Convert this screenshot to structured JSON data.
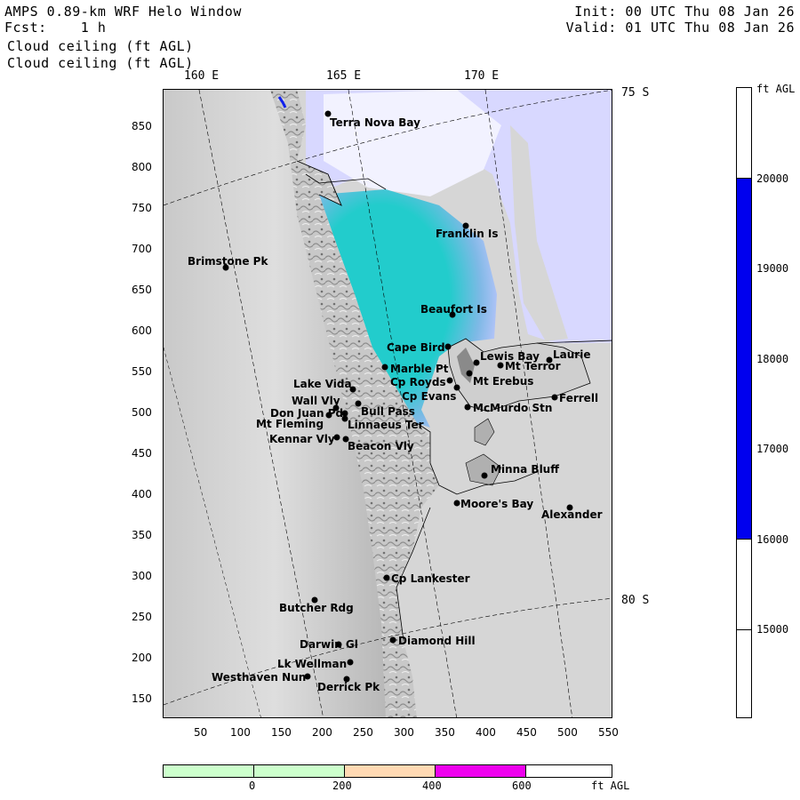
{
  "header": {
    "line1_left": "AMPS 0.89-km WRF Helo Window",
    "line2_left": "Fcst:    1 h",
    "line3": "Cloud ceiling (ft AGL)",
    "line4": "Cloud ceiling (ft AGL)",
    "line1_right": "Init: 00 UTC Thu 08 Jan 26",
    "line2_right": "Valid: 01 UTC Thu 08 Jan 26"
  },
  "map": {
    "lon_labels": [
      "160 E",
      "165 E",
      "170 E"
    ],
    "lat_labels": [
      "75 S",
      "80 S"
    ],
    "y_ticks": [
      "850",
      "800",
      "750",
      "700",
      "650",
      "600",
      "550",
      "500",
      "450",
      "400",
      "350",
      "300",
      "250",
      "200",
      "150"
    ],
    "x_ticks": [
      "50",
      "100",
      "150",
      "200",
      "250",
      "300",
      "350",
      "400",
      "450",
      "500",
      "550"
    ],
    "places": [
      {
        "name": "Terra Nova Bay"
      },
      {
        "name": "Franklin Is"
      },
      {
        "name": "Brimstone Pk"
      },
      {
        "name": "Beaufort Is"
      },
      {
        "name": "Cape Bird"
      },
      {
        "name": "Lewis Bay"
      },
      {
        "name": "Laurie"
      },
      {
        "name": "Mt Terror"
      },
      {
        "name": "Marble Pt"
      },
      {
        "name": "Cp Royds"
      },
      {
        "name": "Mt Erebus"
      },
      {
        "name": "Lake Vida"
      },
      {
        "name": "Cp Evans"
      },
      {
        "name": "Ferrell"
      },
      {
        "name": "Wall Vly"
      },
      {
        "name": "McMurdo Stn"
      },
      {
        "name": "Bull Pass"
      },
      {
        "name": "Don Juan Pd"
      },
      {
        "name": "Mt Fleming"
      },
      {
        "name": "Linnaeus Ter"
      },
      {
        "name": "Kennar Vly"
      },
      {
        "name": "Beacon Vly"
      },
      {
        "name": "Minna Bluff"
      },
      {
        "name": "Moore's Bay"
      },
      {
        "name": "Alexander"
      },
      {
        "name": "Cp Lankester"
      },
      {
        "name": "Butcher Rdg"
      },
      {
        "name": "Darwin Gl"
      },
      {
        "name": "Diamond Hill"
      },
      {
        "name": "Lk Wellman"
      },
      {
        "name": "Westhaven Nun"
      },
      {
        "name": "Derrick Pk"
      }
    ]
  },
  "ceiling_colorbar": {
    "unit": "ft AGL",
    "labels": [
      "20000",
      "19000",
      "18000",
      "17000",
      "16000",
      "15000"
    ],
    "colors": {
      "band": "#0000ee",
      "white": "#ffffff"
    }
  },
  "height_colorbar": {
    "labels": [
      "0",
      "200",
      "400",
      "600"
    ],
    "unit": "ft AGL",
    "colors": [
      "#ccffcc",
      "#ccffcc",
      "#ffd9b3",
      "#ee00ee",
      "#ffffff"
    ]
  },
  "colors": {
    "cyan_fill": "#22cccc",
    "lavender_fill": "#d8d8ff",
    "ocean_gray": "#d8d8d8"
  }
}
